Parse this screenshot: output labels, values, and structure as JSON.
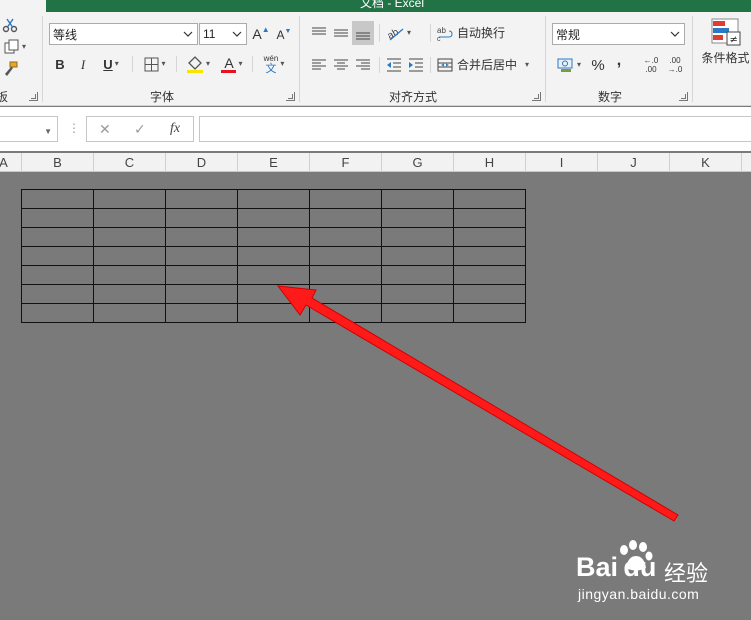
{
  "title_bar": {
    "text": "文档 - Excel"
  },
  "ribbon": {
    "clipboard": {
      "label": "板"
    },
    "font": {
      "name": "等线",
      "size": "11",
      "grow": "A",
      "shrink": "A",
      "bold": "B",
      "italic": "I",
      "underline": "U",
      "font_color_glyph": "A",
      "phonetic_top": "wén",
      "phonetic_bottom": "文",
      "group_label": "字体",
      "font_color": "#e81123"
    },
    "alignment": {
      "wrap_label": "自动换行",
      "merge_label": "合并后居中",
      "group_label": "对齐方式"
    },
    "number": {
      "format": "常规",
      "percent": "%",
      "comma": ",",
      "inc_decimal_top": "←.0",
      "inc_decimal_bottom": ".00",
      "dec_decimal_top": ".00",
      "dec_decimal_bottom": "→.0",
      "group_label": "数字"
    },
    "styles": {
      "conditional_format": "条件格式"
    }
  },
  "formula_bar": {
    "cancel": "✕",
    "confirm": "✓",
    "fx": "fx",
    "dots": "⋮"
  },
  "columns": [
    "A",
    "B",
    "C",
    "D",
    "E",
    "F",
    "G",
    "H",
    "I",
    "J",
    "K"
  ],
  "table": {
    "rows": 7,
    "cols": 7
  },
  "watermark": {
    "brand": "Bai du",
    "cn": "经验",
    "url": "jingyan.baidu.com"
  },
  "colors": {
    "title_green": "#217346",
    "sheet_gray": "#7a7a7a",
    "arrow_red": "#ff1a1a"
  }
}
